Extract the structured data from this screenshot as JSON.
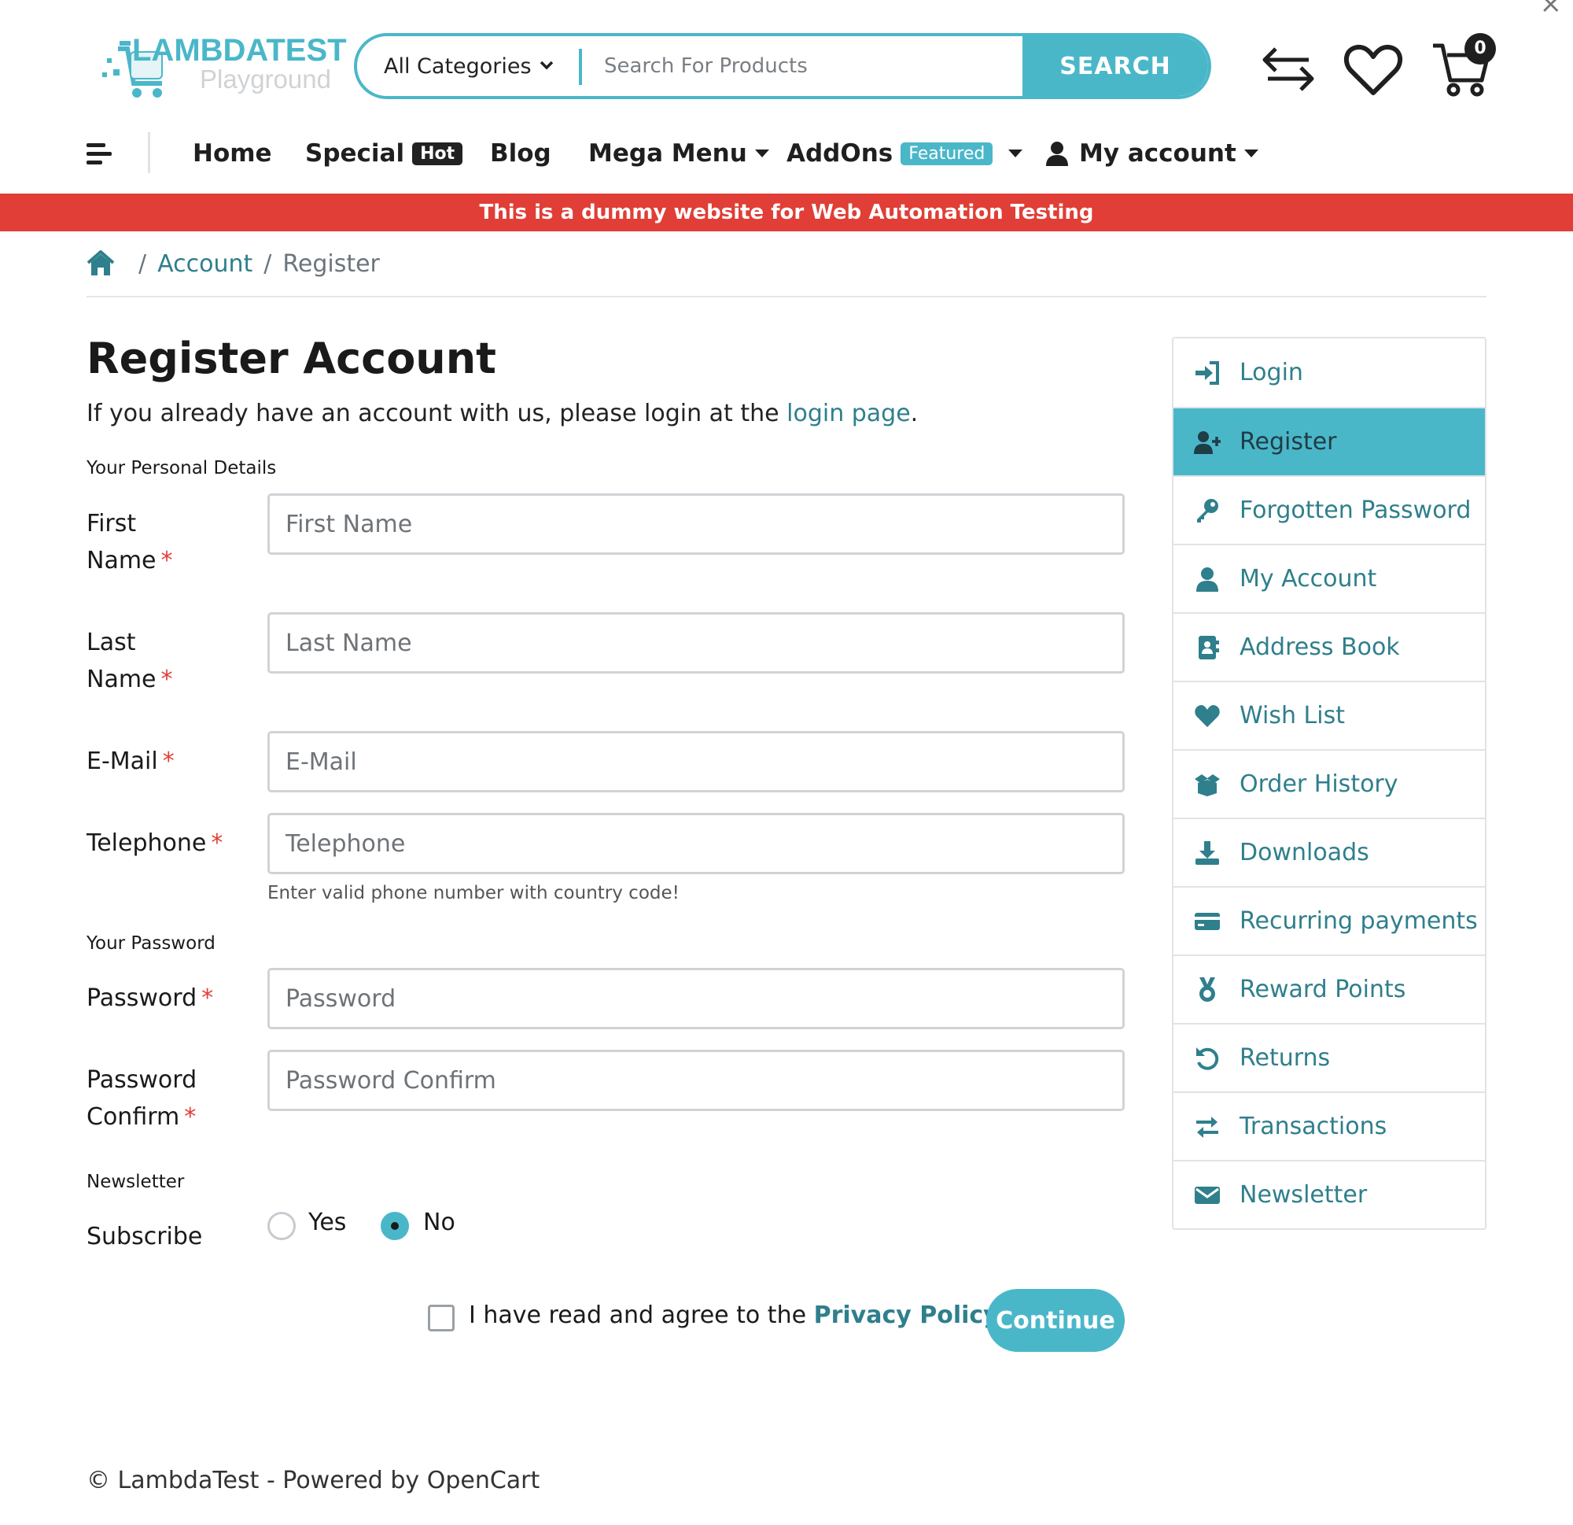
{
  "header": {
    "brand": "LAMBDATEST",
    "brand_sub": "Playground",
    "category_select": "All Categories",
    "search_placeholder": "Search For Products",
    "search_button": "SEARCH",
    "cart_count": "0"
  },
  "nav": {
    "items": [
      {
        "label": "Home"
      },
      {
        "label": "Special",
        "badge": "Hot"
      },
      {
        "label": "Blog"
      },
      {
        "label": "Mega Menu"
      },
      {
        "label": "AddOns",
        "badge": "Featured"
      },
      {
        "label": "My account"
      }
    ]
  },
  "banner": "This is a dummy website for Web Automation Testing",
  "breadcrumb": {
    "items": [
      "Account",
      "Register"
    ],
    "separator": "/"
  },
  "page": {
    "title": "Register Account",
    "intro_text": "If you already have an account with us, please login at the ",
    "intro_link": "login page",
    "intro_end": "."
  },
  "form": {
    "personal_legend": "Your Personal Details",
    "first_name": {
      "label_1": "First",
      "label_2": "Name",
      "placeholder": "First Name"
    },
    "last_name": {
      "label_1": "Last",
      "label_2": "Name",
      "placeholder": "Last Name"
    },
    "email": {
      "label": "E-Mail",
      "placeholder": "E-Mail"
    },
    "telephone": {
      "label": "Telephone",
      "placeholder": "Telephone",
      "help": "Enter valid phone number with country code!"
    },
    "password_legend": "Your Password",
    "password": {
      "label": "Password",
      "placeholder": "Password"
    },
    "password_confirm": {
      "label_1": "Password",
      "label_2": "Confirm",
      "placeholder": "Password Confirm"
    },
    "newsletter_legend": "Newsletter",
    "subscribe_label": "Subscribe",
    "subscribe_options": [
      {
        "label": "Yes",
        "checked": false
      },
      {
        "label": "No",
        "checked": true
      }
    ],
    "required_mark": "*",
    "agree_text": "I have read and agree to the ",
    "agree_link": "Privacy Policy",
    "agree_checked": false,
    "continue_button": "Continue"
  },
  "sidebar": {
    "items": [
      {
        "label": "Login",
        "icon": "sign-in-icon",
        "active": false
      },
      {
        "label": "Register",
        "icon": "user-plus-icon",
        "active": true
      },
      {
        "label": "Forgotten Password",
        "icon": "key-icon",
        "active": false
      },
      {
        "label": "My Account",
        "icon": "user-icon",
        "active": false
      },
      {
        "label": "Address Book",
        "icon": "address-book-icon",
        "active": false
      },
      {
        "label": "Wish List",
        "icon": "heart-icon",
        "active": false
      },
      {
        "label": "Order History",
        "icon": "box-open-icon",
        "active": false
      },
      {
        "label": "Downloads",
        "icon": "download-icon",
        "active": false
      },
      {
        "label": "Recurring payments",
        "icon": "credit-card-icon",
        "active": false
      },
      {
        "label": "Reward Points",
        "icon": "medal-icon",
        "active": false
      },
      {
        "label": "Returns",
        "icon": "undo-icon",
        "active": false
      },
      {
        "label": "Transactions",
        "icon": "exchange-icon",
        "active": false
      },
      {
        "label": "Newsletter",
        "icon": "envelope-icon",
        "active": false
      }
    ]
  },
  "footer": "© LambdaTest - Powered by OpenCart",
  "colors": {
    "accent": "#4ab7c9",
    "link": "#2f7f8c",
    "banner": "#e03e36",
    "required": "#e03e36"
  }
}
